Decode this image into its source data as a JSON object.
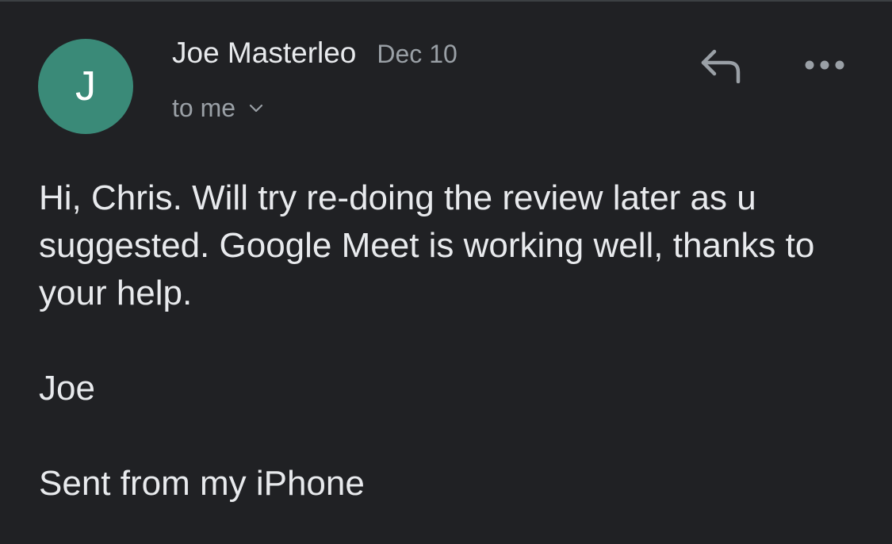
{
  "sender": {
    "avatar_initial": "J",
    "avatar_color": "#3a8a78",
    "name": "Joe Masterleo",
    "date": "Dec 10"
  },
  "recipient": {
    "label": "to me",
    "icon": "chevron-down-icon"
  },
  "actions": {
    "reply_icon": "reply-icon",
    "more_icon": "more-horizontal-icon"
  },
  "message": {
    "body": "Hi, Chris. Will try re-doing the review later as u suggested. Google Meet is working well, thanks to your help.",
    "signature": "Joe",
    "footer": "Sent from my iPhone"
  },
  "colors": {
    "background": "#202124",
    "primary_text": "#e8eaed",
    "secondary_text": "#9aa0a6"
  }
}
